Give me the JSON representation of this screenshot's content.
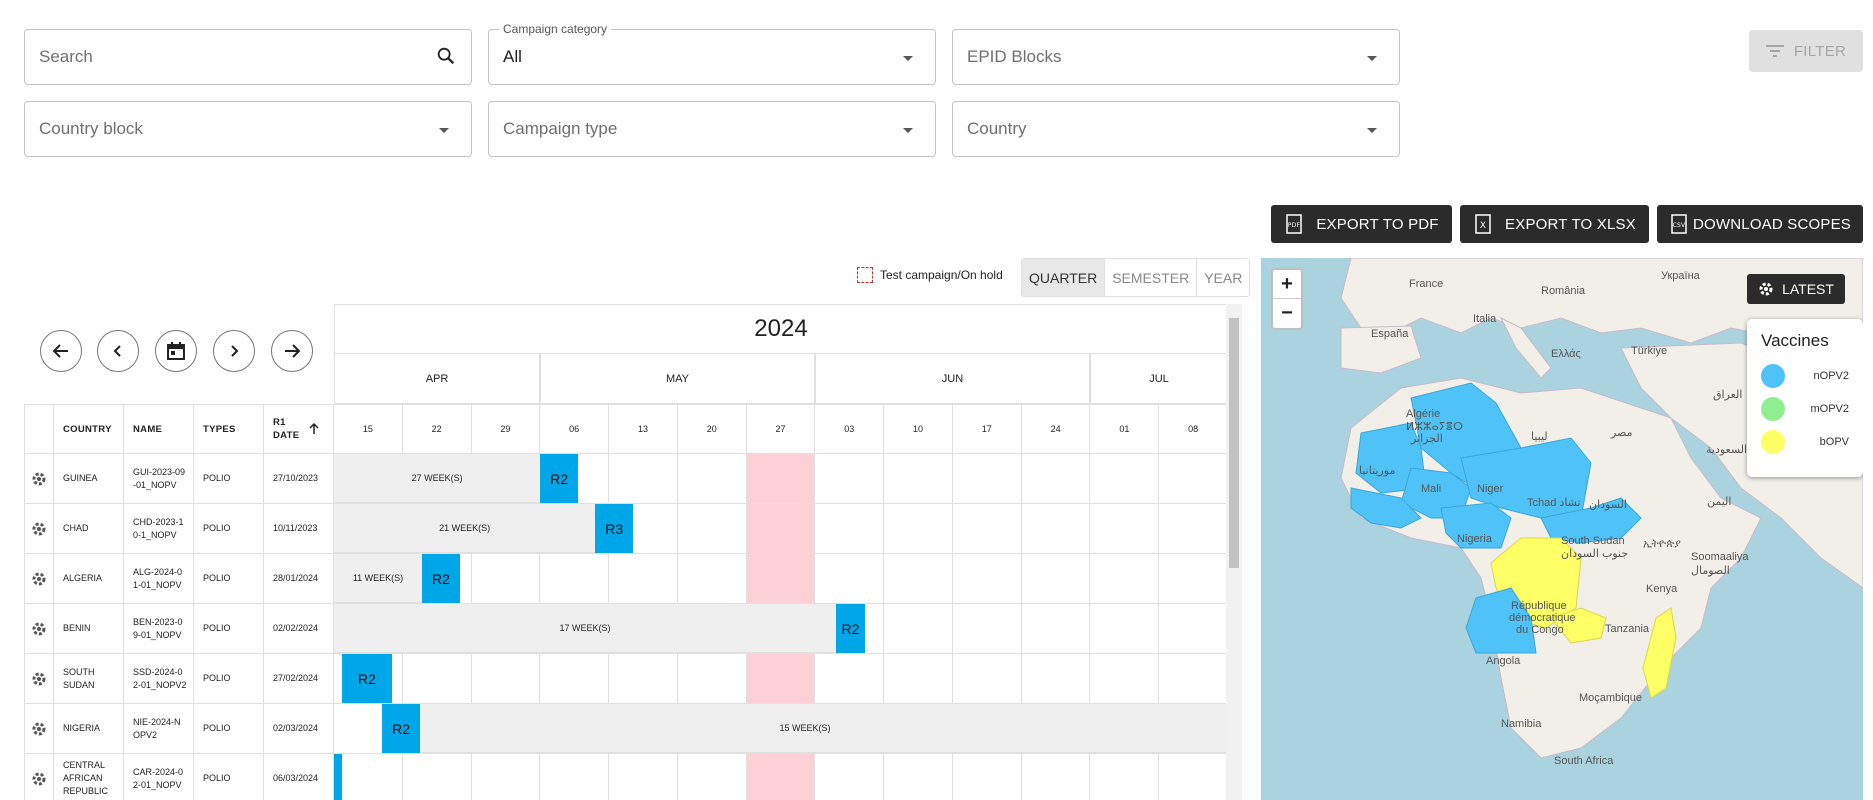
{
  "filters": {
    "search_placeholder": "Search",
    "campaign_category_label": "Campaign category",
    "campaign_category_value": "All",
    "epid_blocks_placeholder": "EPID Blocks",
    "country_block_placeholder": "Country block",
    "campaign_type_placeholder": "Campaign type",
    "country_placeholder": "Country",
    "filter_button": "FILTER"
  },
  "exports": {
    "pdf": "EXPORT TO PDF",
    "xlsx": "EXPORT TO XLSX",
    "scopes": "DOWNLOAD SCOPES"
  },
  "calendar": {
    "legend_label": "Test campaign/On hold",
    "periods": [
      "QUARTER",
      "SEMESTER",
      "YEAR"
    ],
    "active_period": "QUARTER",
    "year": "2024",
    "months": [
      "APR",
      "MAY",
      "JUN",
      "JUL"
    ],
    "columns": {
      "country": "COUNTRY",
      "name": "NAME",
      "types": "TYPES",
      "r1_date": "R1 DATE"
    },
    "weeks": [
      "15",
      "22",
      "29",
      "06",
      "13",
      "20",
      "27",
      "03",
      "10",
      "17",
      "24",
      "01",
      "08"
    ],
    "rows": [
      {
        "country": "GUINEA",
        "name": "GUI-2023-09-01_NOPV",
        "type": "POLIO",
        "r1_date": "27/10/2023",
        "bar_label": "27 WEEK(S)",
        "round": "R2"
      },
      {
        "country": "CHAD",
        "name": "CHD-2023-10-1_NOPV",
        "type": "POLIO",
        "r1_date": "10/11/2023",
        "bar_label": "21 WEEK(S)",
        "round": "R3"
      },
      {
        "country": "ALGERIA",
        "name": "ALG-2024-01-01_NOPV",
        "type": "POLIO",
        "r1_date": "28/01/2024",
        "bar_label": "11 WEEK(S)",
        "round": "R2"
      },
      {
        "country": "BENIN",
        "name": "BEN-2023-09-01_NOPV",
        "type": "POLIO",
        "r1_date": "02/02/2024",
        "bar_label": "17 WEEK(S)",
        "round": "R2"
      },
      {
        "country": "SOUTH SUDAN",
        "name": "SSD-2024-02-01_NOPV2",
        "type": "POLIO",
        "r1_date": "27/02/2024",
        "bar_label": "",
        "round": "R2"
      },
      {
        "country": "NIGERIA",
        "name": "NIE-2024-NOPV2",
        "type": "POLIO",
        "r1_date": "02/03/2024",
        "bar_label": "15 WEEK(S)",
        "round": "R2"
      },
      {
        "country": "CENTRAL AFRICAN REPUBLIC",
        "name": "CAR-2024-02-01_NOPV",
        "type": "POLIO",
        "r1_date": "06/03/2024",
        "bar_label": "",
        "round": ""
      }
    ]
  },
  "map": {
    "latest_button": "LATEST",
    "vaccines_title": "Vaccines",
    "vaccines": [
      {
        "name": "nOPV2",
        "color": "#4fc3f7"
      },
      {
        "name": "mOPV2",
        "color": "#90ee90"
      },
      {
        "name": "bOPV",
        "color": "#ffff66"
      }
    ],
    "labels": {
      "france": "France",
      "romania": "România",
      "ukraine": "Україна",
      "italy": "Italia",
      "spain": "España",
      "greece": "Ελλάς",
      "turkey": "Türkiye",
      "algeria": "Algérie",
      "algeria_ber": "ⵍⵣⵣⴰⵢⴻⵔ",
      "algeria_ar": "الجزائر",
      "libya": "ليبيا",
      "egypt": "مصر",
      "iraq": "العراق",
      "saudi": "السعودية",
      "mauritania": "موريتانيا",
      "mali": "Mali",
      "niger": "Niger",
      "tchad": "Tchad تشاد",
      "sudan": "السودان",
      "yemen": "اليمن",
      "nigeria": "Nigeria",
      "south_sudan": "South Sudan",
      "south_sudan_ar": "جنوب السودان",
      "somalia": "Soomaaliya",
      "somalia_ar": "الصومال",
      "ethiopia": "ኢትዮጵያ",
      "kenya": "Kenya",
      "drc1": "République",
      "drc2": "démocratique",
      "drc3": "du Congo",
      "tanzania": "Tanzania",
      "angola": "Angola",
      "mozambique": "Moçambique",
      "namibia": "Namibia",
      "south_africa": "South Africa"
    }
  }
}
